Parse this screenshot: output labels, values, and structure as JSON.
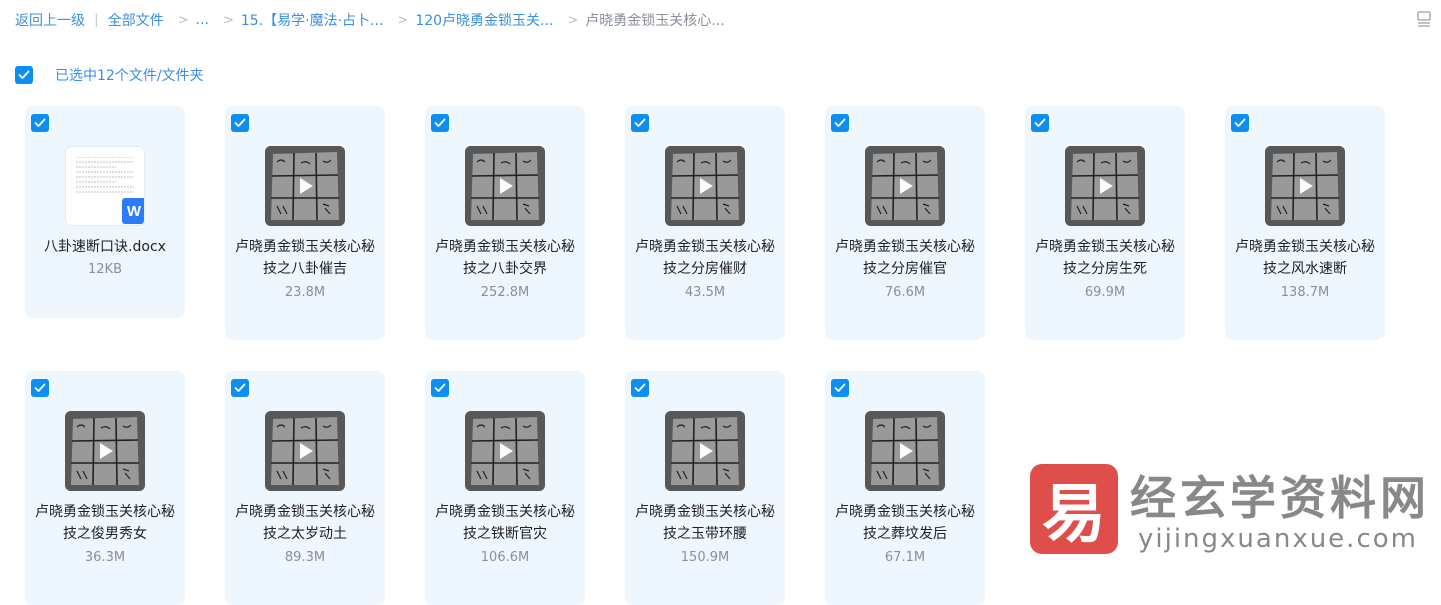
{
  "breadcrumb": {
    "back": "返回上一级",
    "divider": "|",
    "all_files": "全部文件",
    "ellipsis": "...",
    "folder_1": "15.【易学·魔法·占卜...",
    "folder_2": "120卢晓勇金锁玉关...",
    "current": "卢晓勇金锁玉关核心..."
  },
  "selection": {
    "text": "已选中12个文件/文件夹",
    "all_checked": true
  },
  "files": [
    {
      "name": "八卦速断口诀.docx",
      "size": "12KB",
      "type": "docx",
      "checked": true,
      "badge": "W"
    },
    {
      "name": "卢晓勇金锁玉关核心秘技之八卦催吉",
      "size": "23.8M",
      "type": "video",
      "checked": true
    },
    {
      "name": "卢晓勇金锁玉关核心秘技之八卦交界",
      "size": "252.8M",
      "type": "video",
      "checked": true
    },
    {
      "name": "卢晓勇金锁玉关核心秘技之分房催财",
      "size": "43.5M",
      "type": "video",
      "checked": true
    },
    {
      "name": "卢晓勇金锁玉关核心秘技之分房催官",
      "size": "76.6M",
      "type": "video",
      "checked": true
    },
    {
      "name": "卢晓勇金锁玉关核心秘技之分房生死",
      "size": "69.9M",
      "type": "video",
      "checked": true
    },
    {
      "name": "卢晓勇金锁玉关核心秘技之风水速断",
      "size": "138.7M",
      "type": "video",
      "checked": true
    },
    {
      "name": "卢晓勇金锁玉关核心秘技之俊男秀女",
      "size": "36.3M",
      "type": "video",
      "checked": true
    },
    {
      "name": "卢晓勇金锁玉关核心秘技之太岁动土",
      "size": "89.3M",
      "type": "video",
      "checked": true
    },
    {
      "name": "卢晓勇金锁玉关核心秘技之铁断官灾",
      "size": "106.6M",
      "type": "video",
      "checked": true
    },
    {
      "name": "卢晓勇金锁玉关核心秘技之玉带环腰",
      "size": "150.9M",
      "type": "video",
      "checked": true
    },
    {
      "name": "卢晓勇金锁玉关核心秘技之葬坟发后",
      "size": "67.1M",
      "type": "video",
      "checked": true
    }
  ],
  "watermark": {
    "logo_char": "易",
    "title": "经玄学资料网",
    "url": "yijingxuanxue.com"
  },
  "colors": {
    "accent": "#0d8ef2",
    "link": "#3a8fe0",
    "card_bg": "#eef6fe"
  },
  "icons": {
    "view_toggle": "list-view-icon",
    "play": "play-icon",
    "checkbox": "checkmark-icon"
  }
}
